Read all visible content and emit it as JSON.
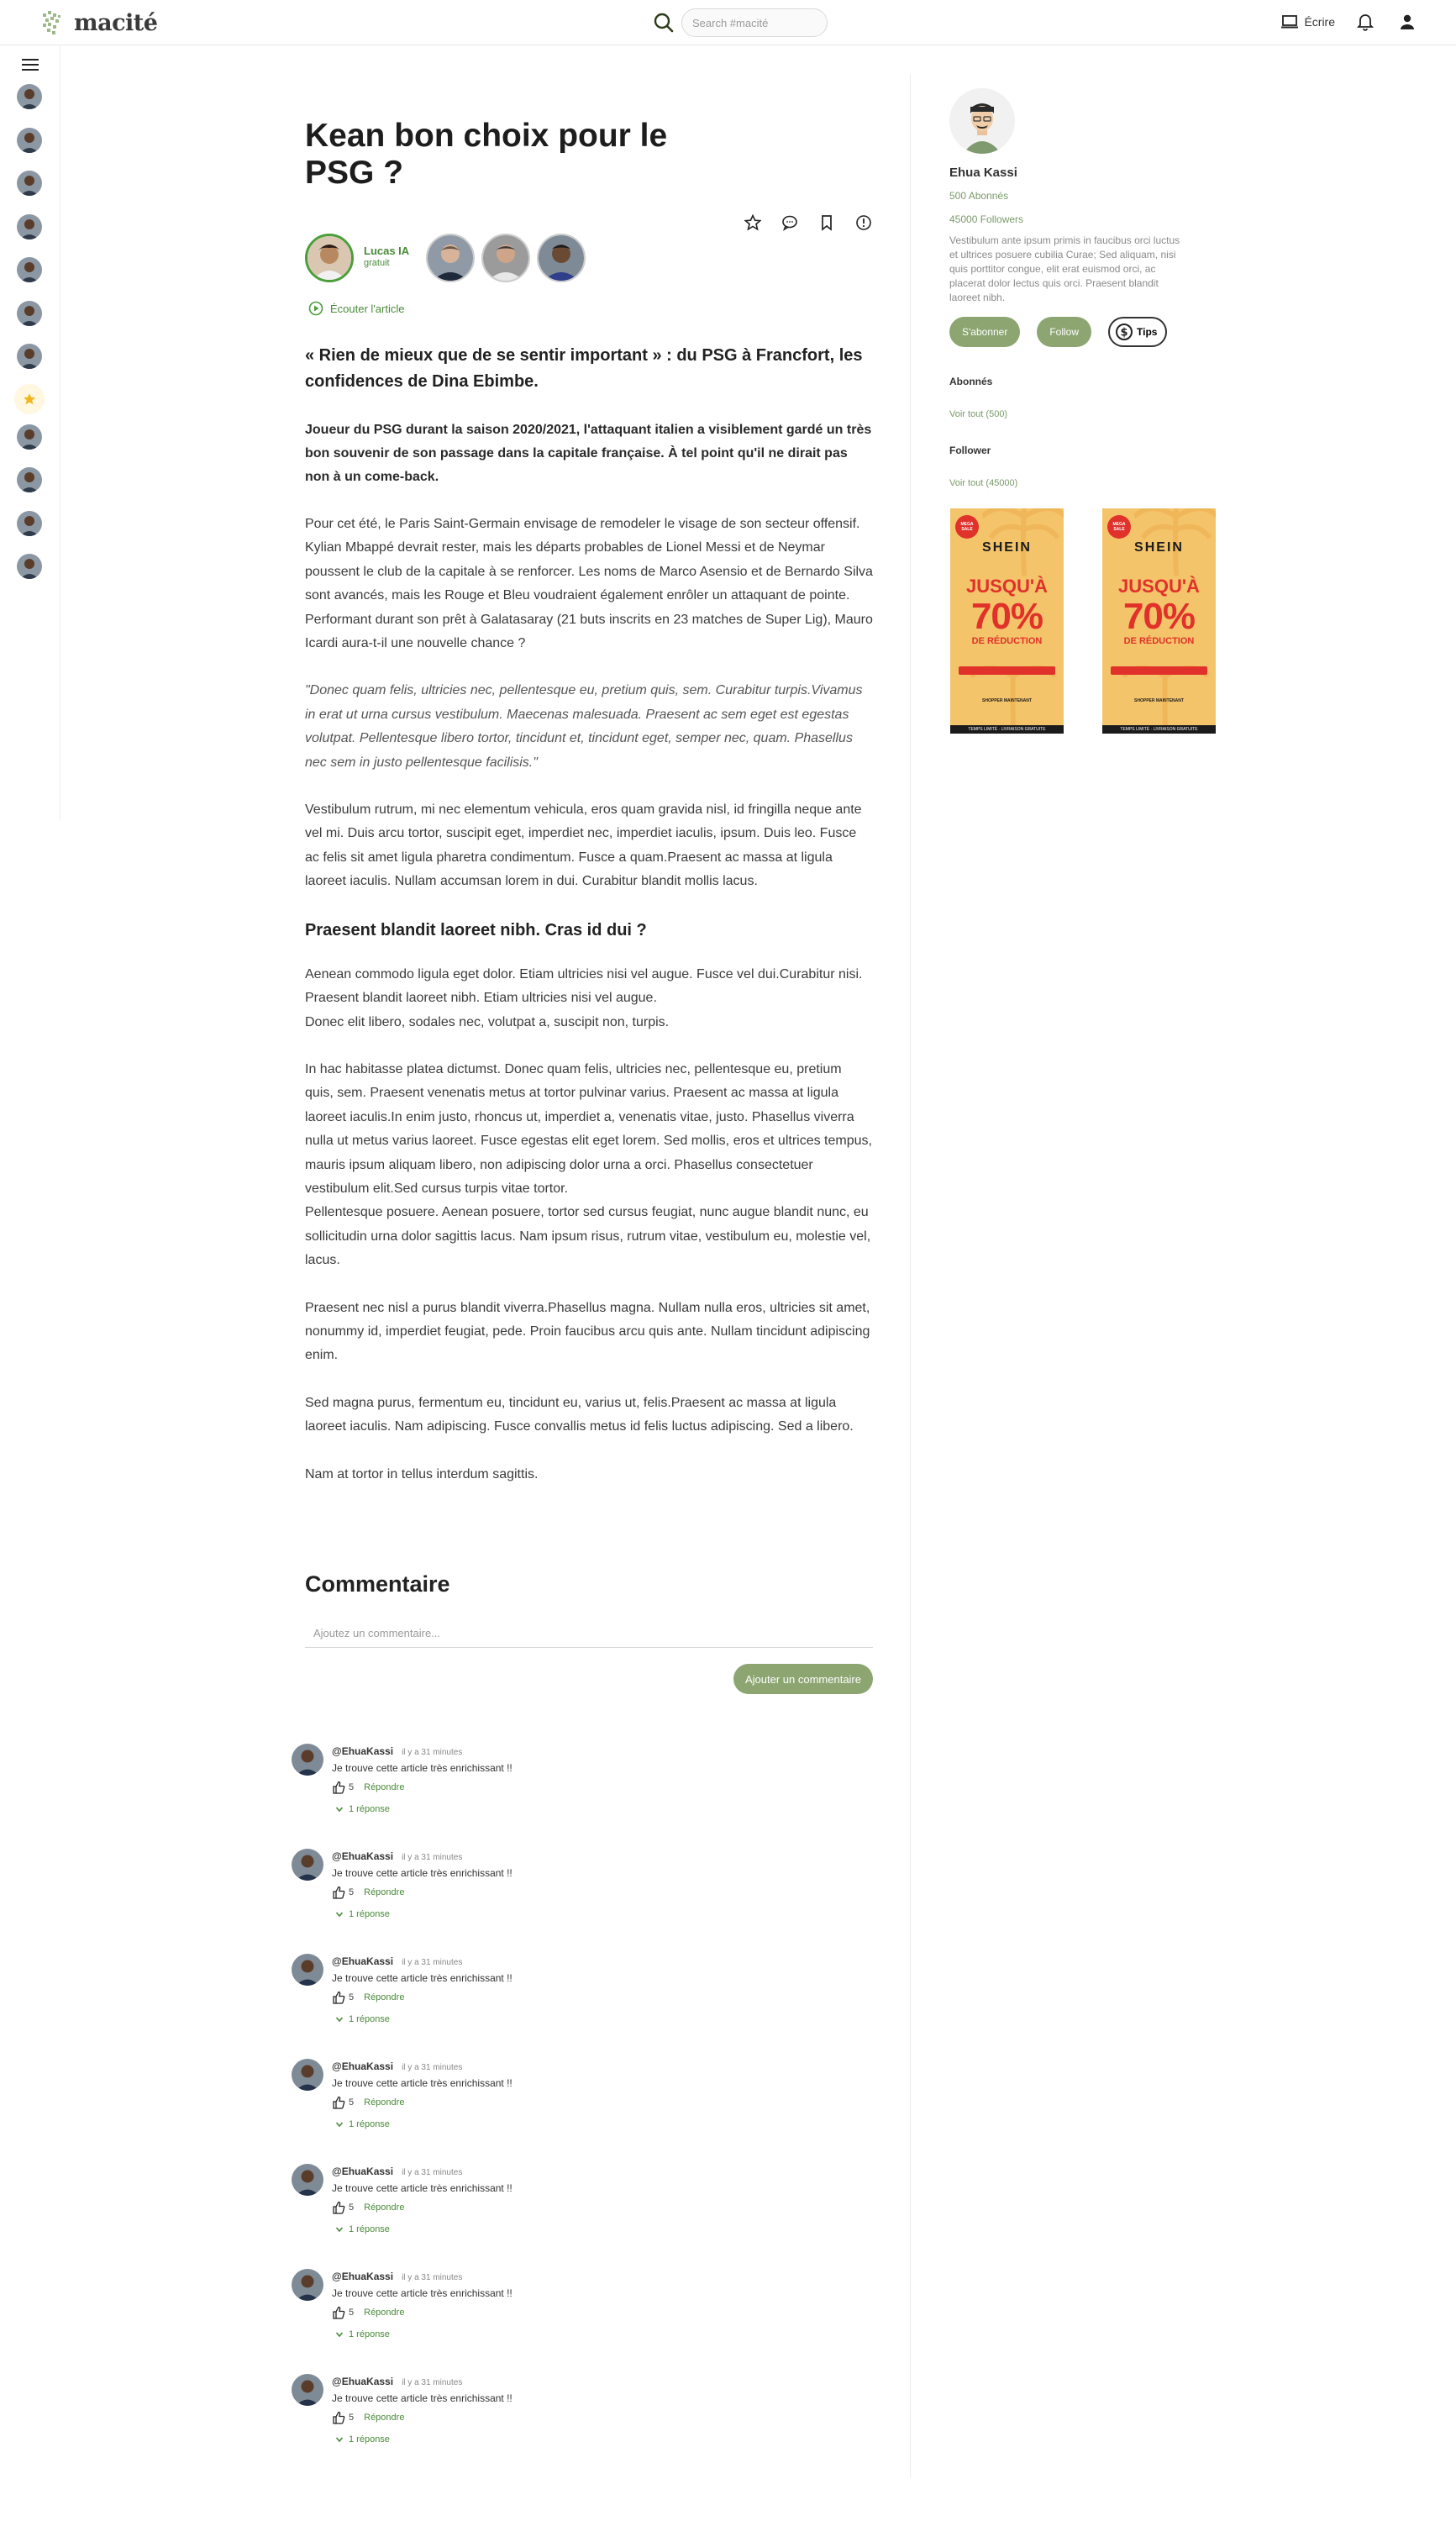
{
  "header": {
    "logo_text": "macité",
    "search_placeholder": "Search #macité",
    "write_label": "Écrire"
  },
  "article": {
    "title": "Kean bon choix pour le PSG ?",
    "author": {
      "name": "Lucas IA",
      "tag": "gratuit"
    },
    "listen_label": "Écouter l'article",
    "lead": "« Rien de mieux que de se sentir important » : du PSG à Francfort, les confidences de Dina Ebimbe.",
    "intro": "Joueur du PSG durant la saison 2020/2021, l'attaquant italien a visiblement gardé un très bon souvenir de son passage dans la capitale française. À tel point qu'il ne dirait pas non à un come-back.",
    "p1": "Pour cet été, le Paris Saint-Germain envisage de remodeler le visage de son secteur offensif. Kylian Mbappé devrait rester, mais les départs probables de Lionel Messi et de Neymar poussent le club de la capitale à se renforcer. Les noms de Marco Asensio et de Bernardo Silva sont avancés, mais les Rouge et Bleu voudraient également enrôler un attaquant de pointe. Performant durant son prêt à Galatasaray (21 buts inscrits en 23 matches de Super Lig), Mauro Icardi aura-t-il une nouvelle chance ?",
    "quote": "\"Donec quam felis, ultricies nec, pellentesque eu, pretium quis, sem. Curabitur turpis.Vivamus in erat ut urna cursus vestibulum. Maecenas malesuada. Praesent ac sem eget est egestas volutpat. Pellentesque libero tortor, tincidunt et, tincidunt eget, semper nec, quam. Phasellus nec sem in justo pellentesque facilisis.\"",
    "p2": "Vestibulum rutrum, mi nec elementum vehicula, eros quam gravida nisl, id fringilla neque ante vel mi. Duis arcu tortor, suscipit eget, imperdiet nec, imperdiet iaculis, ipsum. Duis leo. Fusce ac felis sit amet ligula pharetra condimentum. Fusce a quam.Praesent ac massa at ligula laoreet iaculis. Nullam accumsan lorem in dui. Curabitur blandit mollis lacus.",
    "subhead": "Praesent blandit laoreet nibh. Cras id dui ?",
    "p3a": "Aenean commodo ligula eget dolor. Etiam ultricies nisi vel augue. Fusce vel dui.Curabitur nisi. Praesent blandit laoreet nibh. Etiam ultricies nisi vel augue.",
    "p3b": "Donec elit libero, sodales nec, volutpat a, suscipit non, turpis.",
    "p4a": "In hac habitasse platea dictumst. Donec quam felis, ultricies nec, pellentesque eu, pretium quis, sem. Praesent venenatis metus at tortor pulvinar varius. Praesent ac massa at ligula laoreet iaculis.In enim justo, rhoncus ut, imperdiet a, venenatis vitae, justo. Phasellus viverra nulla ut metus varius laoreet. Fusce egestas elit eget lorem. Sed mollis, eros et ultrices tempus, mauris ipsum aliquam libero, non adipiscing dolor urna a orci. Phasellus consectetuer vestibulum elit.Sed cursus turpis vitae tortor.",
    "p4b": "Pellentesque posuere. Aenean posuere, tortor sed cursus feugiat, nunc augue blandit nunc, eu sollicitudin urna dolor sagittis lacus. Nam ipsum risus, rutrum vitae, vestibulum eu, molestie vel, lacus.",
    "p5": "Praesent nec nisl a purus blandit viverra.Phasellus magna. Nullam nulla eros, ultricies sit amet, nonummy id, imperdiet feugiat, pede. Proin faucibus arcu quis ante. Nullam tincidunt adipiscing enim.",
    "p6": "Sed magna purus, fermentum eu, tincidunt eu, varius ut, felis.Praesent ac massa at ligula laoreet iaculis. Nam adipiscing. Fusce convallis metus id felis luctus adipiscing. Sed a libero.",
    "p7": "Nam at tortor in tellus interdum sagittis."
  },
  "comments": {
    "title": "Commentaire",
    "input_placeholder": "Ajoutez un commentaire...",
    "submit_label": "Ajouter un commentaire",
    "items": [
      {
        "user": "@EhuaKassi",
        "time": "il y a 31 minutes",
        "text": "Je trouve cette article très enrichissant !!",
        "likes": "5",
        "reply_label": "Répondre",
        "replies_label": "1 réponse"
      },
      {
        "user": "@EhuaKassi",
        "time": "il y a 31 minutes",
        "text": "Je trouve cette article très enrichissant !!",
        "likes": "5",
        "reply_label": "Répondre",
        "replies_label": "1 réponse"
      },
      {
        "user": "@EhuaKassi",
        "time": "il y a 31 minutes",
        "text": "Je trouve cette article très enrichissant !!",
        "likes": "5",
        "reply_label": "Répondre",
        "replies_label": "1 réponse"
      },
      {
        "user": "@EhuaKassi",
        "time": "il y a 31 minutes",
        "text": "Je trouve cette article très enrichissant !!",
        "likes": "5",
        "reply_label": "Répondre",
        "replies_label": "1 réponse"
      },
      {
        "user": "@EhuaKassi",
        "time": "il y a 31 minutes",
        "text": "Je trouve cette article très enrichissant !!",
        "likes": "5",
        "reply_label": "Répondre",
        "replies_label": "1 réponse"
      },
      {
        "user": "@EhuaKassi",
        "time": "il y a 31 minutes",
        "text": "Je trouve cette article très enrichissant !!",
        "likes": "5",
        "reply_label": "Répondre",
        "replies_label": "1 réponse"
      },
      {
        "user": "@EhuaKassi",
        "time": "il y a 31 minutes",
        "text": "Je trouve cette article très enrichissant !!",
        "likes": "5",
        "reply_label": "Répondre",
        "replies_label": "1 réponse"
      }
    ]
  },
  "profile": {
    "name": "Ehua Kassi",
    "subscribers": "500 Abonnés",
    "followers": "45000 Followers",
    "bio": "Vestibulum ante ipsum primis in faucibus orci luctus et ultrices posuere cubilia Curae; Sed aliquam, nisi quis porttitor congue, elit erat euismod orci, ac placerat dolor lectus quis orci. Praesent blandit laoreet nibh.",
    "subscribe_label": "S'abonner",
    "follow_label": "Follow",
    "tips_label": "Tips",
    "subs_section": "Abonnés",
    "subs_link": "Voir tout (500)",
    "followers_section": "Follower",
    "followers_link": "Voir tout (45000)"
  },
  "ads": [
    {
      "badge": "MEGA SALE",
      "brand": "SHEIN",
      "line1": "JUSQU'À",
      "line2": "70%",
      "line3": "DE RÉDUCTION",
      "cta": "SHOPPER MAINTENANT",
      "foot": "TEMPS LIMITÉ · LIVRAISON GRATUITE"
    },
    {
      "badge": "MEGA SALE",
      "brand": "SHEIN",
      "line1": "JUSQU'À",
      "line2": "70%",
      "line3": "DE RÉDUCTION",
      "cta": "SHOPPER MAINTENANT",
      "foot": "TEMPS LIMITÉ · LIVRAISON GRATUITE"
    }
  ],
  "colors": {
    "accent": "#8ca571",
    "author_ring": "#4a9f3a",
    "ad_bg": "#f4c46a",
    "ad_red": "#e0312b"
  }
}
